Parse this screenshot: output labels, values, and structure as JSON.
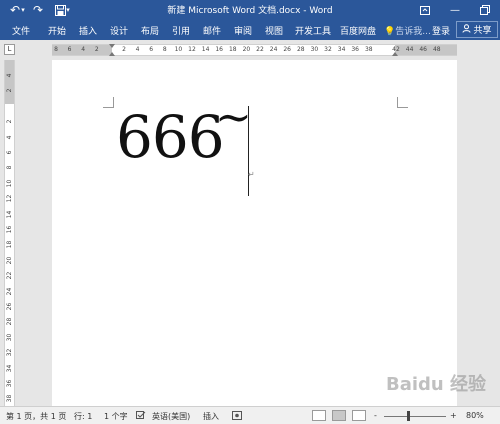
{
  "window": {
    "title": "新建 Microsoft Word 文档.docx - Word",
    "quick_access": {
      "undo_icon": "undo-icon",
      "redo_icon": "redo-icon",
      "save_icon": "save-icon",
      "customize_icon": "chevron-down-icon"
    },
    "controls": {
      "ribbon_display": "ribbon-display-icon",
      "minimize": "minimize-icon",
      "restore": "restore-icon"
    }
  },
  "ribbon": {
    "tabs": [
      "文件",
      "开始",
      "插入",
      "设计",
      "布局",
      "引用",
      "邮件",
      "审阅",
      "视图",
      "开发工具",
      "百度网盘"
    ],
    "tell_me": "告诉我...",
    "login": "登录",
    "share": "共享"
  },
  "ruler": {
    "corner": "L",
    "h_ticks": [
      "8",
      "6",
      "4",
      "2",
      "",
      "2",
      "4",
      "6",
      "8",
      "10",
      "12",
      "14",
      "16",
      "18",
      "20",
      "22",
      "24",
      "26",
      "28",
      "30",
      "32",
      "34",
      "36",
      "38",
      "",
      "42",
      "44",
      "46",
      "48"
    ],
    "v_ticks": [
      "4",
      "2",
      "",
      "2",
      "4",
      "6",
      "8",
      "10",
      "12",
      "14",
      "16",
      "18",
      "20",
      "22",
      "24",
      "26",
      "28",
      "30",
      "32",
      "34",
      "36",
      "38"
    ]
  },
  "document": {
    "text": "666",
    "tilde": "~",
    "para_mark": "↵"
  },
  "status": {
    "page": "第 1 页，共 1 页",
    "position": "行: 1",
    "words": "1 个字",
    "proofing_icon": "proofing-icon",
    "language": "英语(美国)",
    "mode": "插入",
    "macro_icon": "macro-icon",
    "zoom_minus": "-",
    "zoom_plus": "+",
    "zoom": "80%",
    "zoom_level": 0.8
  },
  "watermark": "Baidu 经验"
}
